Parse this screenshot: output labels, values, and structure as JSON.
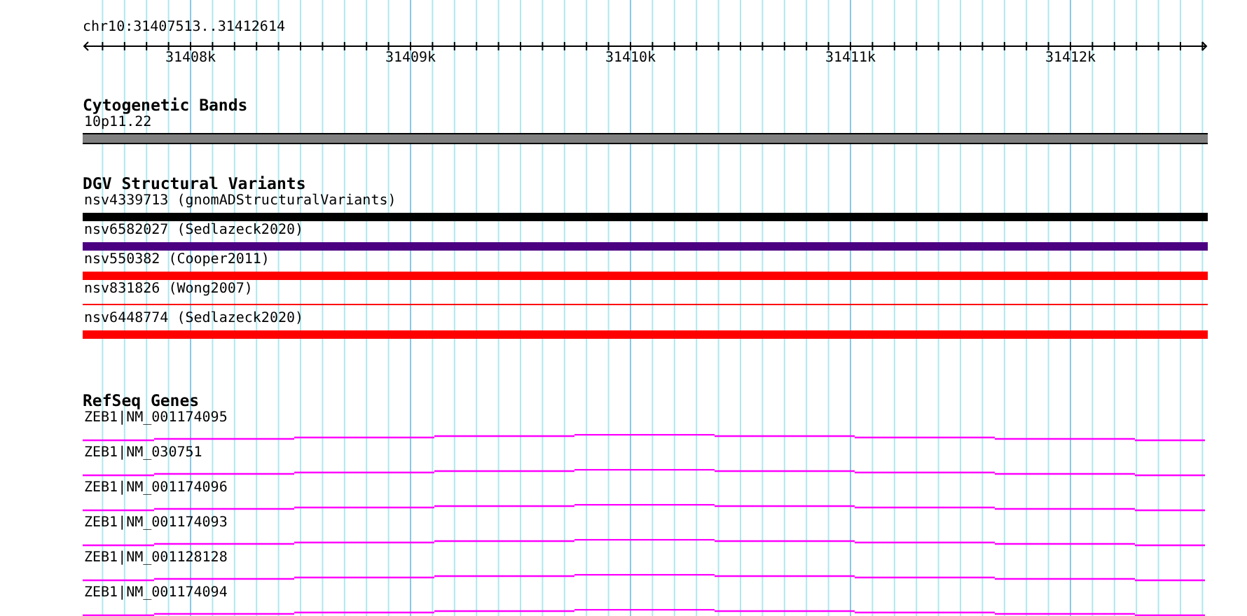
{
  "location": "chr10:31407513..31412614",
  "ruler": {
    "ticks": [
      "31408k",
      "31409k",
      "31410k",
      "31411k",
      "31412k"
    ]
  },
  "tracks": [
    {
      "kind": "cytoband",
      "title": "Cytogenetic Bands",
      "features": [
        {
          "label": "10p11.22",
          "color": "#808080",
          "kind": "thick"
        }
      ]
    },
    {
      "kind": "variants",
      "title": "DGV Structural Variants",
      "features": [
        {
          "label": "nsv4339713 (gnomADStructuralVariants)",
          "color": "#000000",
          "kind": "thick"
        },
        {
          "label": "nsv6582027 (Sedlazeck2020)",
          "color": "#4b0082",
          "kind": "thick"
        },
        {
          "label": "nsv550382 (Cooper2011)",
          "color": "#ff0000",
          "kind": "thick"
        },
        {
          "label": "nsv831826 (Wong2007)",
          "color": "#ff0000",
          "kind": "thin"
        },
        {
          "label": "nsv6448774 (Sedlazeck2020)",
          "color": "#ff0000",
          "kind": "thick"
        }
      ]
    },
    {
      "kind": "genes",
      "title": "RefSeq Genes",
      "features": [
        {
          "label": "ZEB1|NM_001174095",
          "color": "#ff00ff",
          "kind": "gene"
        },
        {
          "label": "ZEB1|NM_030751",
          "color": "#ff00ff",
          "kind": "gene"
        },
        {
          "label": "ZEB1|NM_001174096",
          "color": "#ff00ff",
          "kind": "gene"
        },
        {
          "label": "ZEB1|NM_001174093",
          "color": "#ff00ff",
          "kind": "gene"
        },
        {
          "label": "ZEB1|NM_001128128",
          "color": "#ff00ff",
          "kind": "gene"
        },
        {
          "label": "ZEB1|NM_001174094",
          "color": "#ff00ff",
          "kind": "gene"
        }
      ]
    }
  ]
}
